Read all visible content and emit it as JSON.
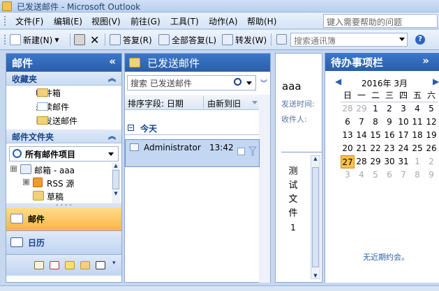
{
  "window": {
    "title": "已发送邮件 - Microsoft Outlook"
  },
  "menu": {
    "items": [
      "文件(F)",
      "编辑(E)",
      "视图(V)",
      "前往(G)",
      "工具(T)",
      "动作(A)",
      "帮助(H)"
    ],
    "help_placeholder": "键入需要帮助的问题"
  },
  "toolbar": {
    "new_label": "新建(N)",
    "reply_label": "答复(R)",
    "reply_all_label": "全部答复(L)",
    "forward_label": "转发(W)",
    "search_contacts_placeholder": "搜索通讯簿"
  },
  "nav": {
    "header": "邮件",
    "collapse": "«",
    "favorites_title": "收藏夹",
    "favorites": [
      "收件箱",
      "未读邮件",
      "已发送邮件"
    ],
    "folders_title": "邮件文件夹",
    "all_items": "所有邮件项目",
    "tree": [
      {
        "label": "邮箱 - aaa",
        "expander": "⊟"
      },
      {
        "label": "RSS 源",
        "expander": "⊞"
      },
      {
        "label": "草稿",
        "expander": ""
      }
    ],
    "mail_button": "邮件",
    "calendar_button": "日历"
  },
  "list": {
    "header": "已发送邮件",
    "search_placeholder": "搜索 已发送邮件",
    "arrange_by": "排序字段: 日期",
    "order": "由新到旧",
    "group_today": "今天",
    "messages": [
      {
        "from": "Administrator",
        "time": "13:42"
      }
    ]
  },
  "reading": {
    "subject": "aaa",
    "sent_label": "发送时间:",
    "to_label": "收件人:",
    "body_lines": [
      "测",
      "试",
      "文",
      "件",
      "1"
    ]
  },
  "todo": {
    "header": "待办事项栏",
    "collapse": "»",
    "month": "2016年 3月",
    "weekdays": [
      "日",
      "一",
      "二",
      "三",
      "四",
      "五",
      "六"
    ],
    "weeks": [
      [
        "28",
        "29",
        "1",
        "2",
        "3",
        "4",
        "5"
      ],
      [
        "6",
        "7",
        "8",
        "9",
        "10",
        "11",
        "12"
      ],
      [
        "13",
        "14",
        "15",
        "16",
        "17",
        "18",
        "19"
      ],
      [
        "20",
        "21",
        "22",
        "23",
        "24",
        "25",
        "26"
      ],
      [
        "27",
        "28",
        "29",
        "30",
        "31",
        "1",
        "2"
      ],
      [
        "3",
        "4",
        "5",
        "6",
        "7",
        "8",
        "9"
      ]
    ],
    "muted_cells": [
      [
        0,
        0
      ],
      [
        0,
        1
      ],
      [
        4,
        5
      ],
      [
        4,
        6
      ],
      [
        5,
        0
      ],
      [
        5,
        1
      ],
      [
        5,
        2
      ],
      [
        5,
        3
      ],
      [
        5,
        4
      ],
      [
        5,
        5
      ],
      [
        5,
        6
      ]
    ],
    "today_cell": [
      4,
      0
    ],
    "no_appointments": "无近期约会。"
  },
  "colors": {
    "header_blue": "#2a5ea8",
    "selected_row": "#c3d7f3",
    "today_highlight": "#f8c046",
    "active_nav_button": "#fbb347"
  }
}
